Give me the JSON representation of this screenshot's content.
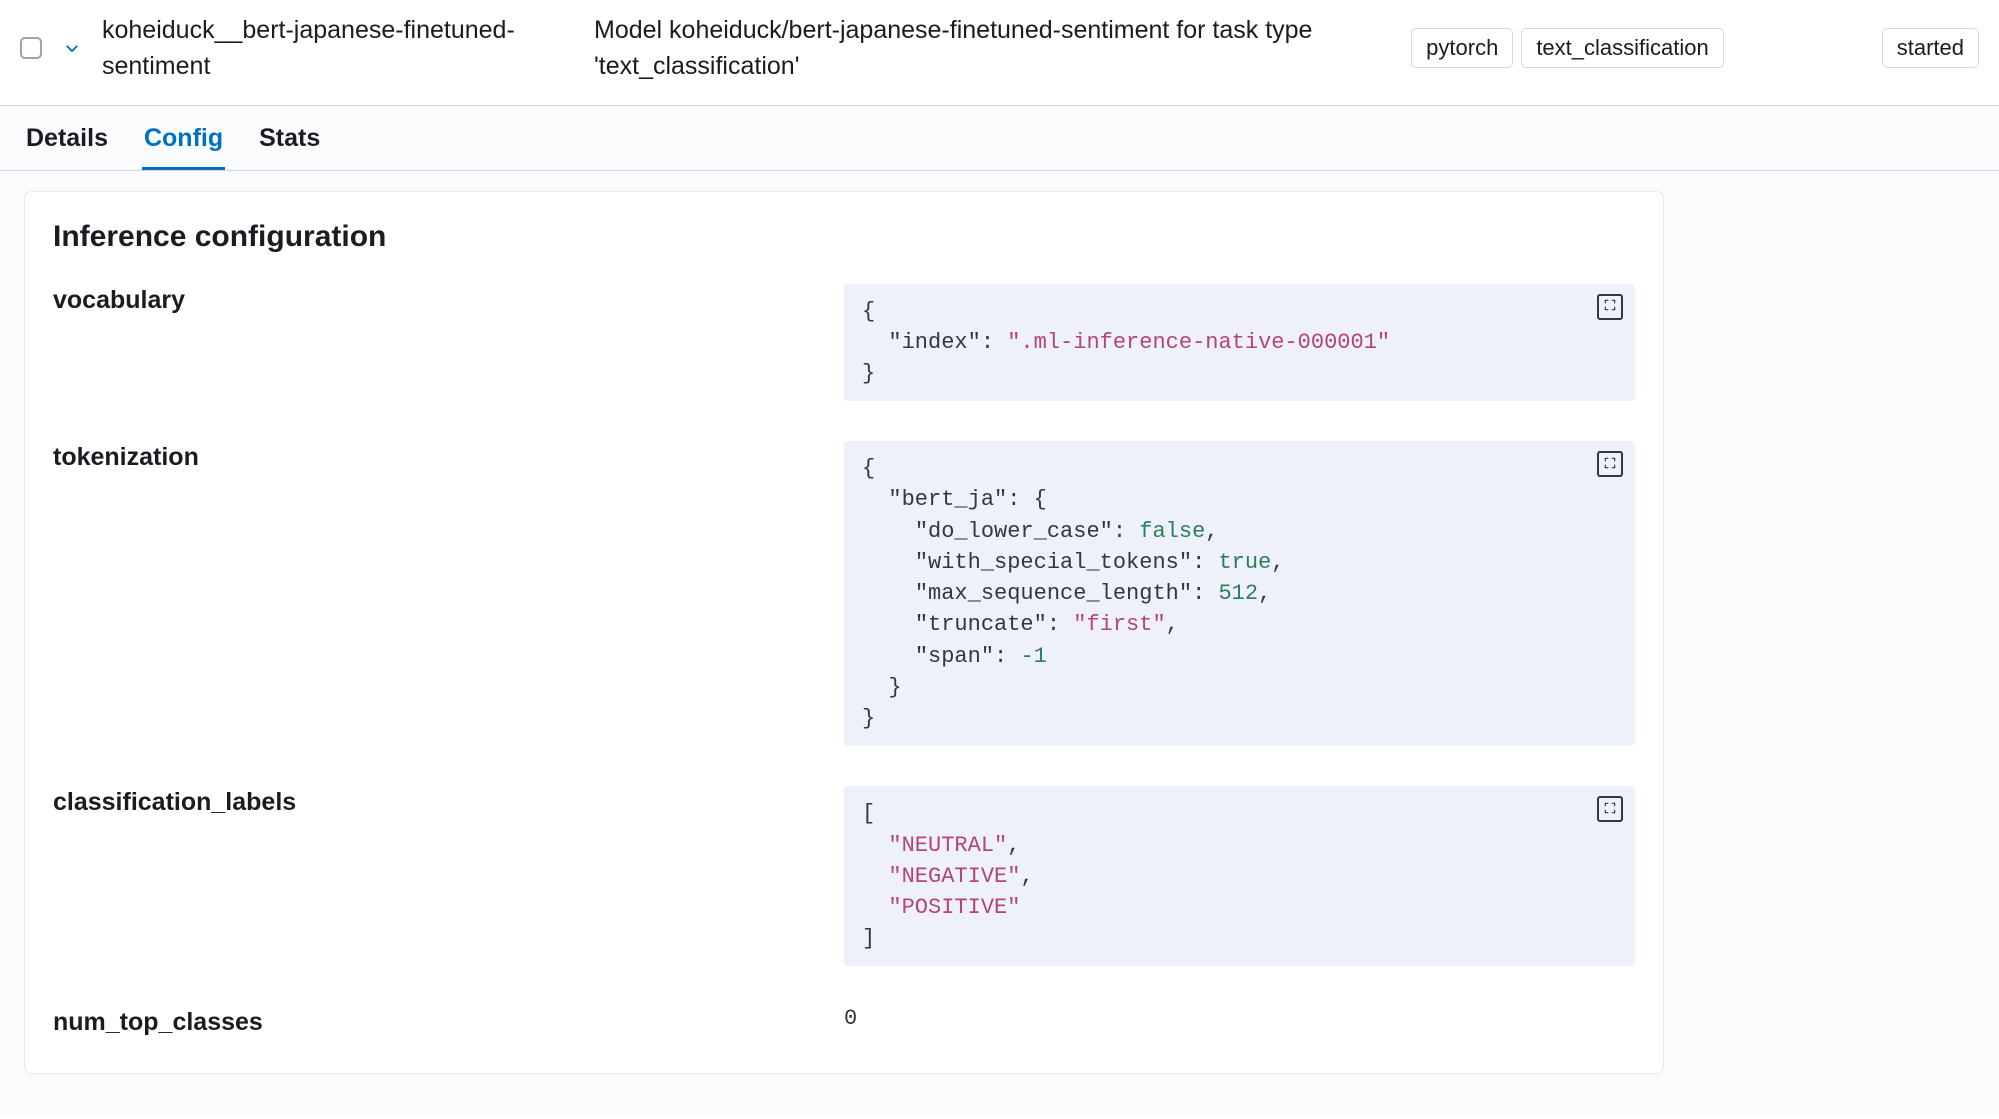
{
  "header": {
    "model_id": "koheiduck__bert-japanese-finetuned-sentiment",
    "description": "Model koheiduck/bert-japanese-finetuned-sentiment for task type 'text_classification'",
    "tags": [
      "pytorch",
      "text_classification"
    ],
    "status": "started"
  },
  "tabs": {
    "details": "Details",
    "config": "Config",
    "stats": "Stats"
  },
  "panel": {
    "title": "Inference configuration",
    "rows": {
      "vocabulary": {
        "label": "vocabulary",
        "value": {
          "index": ".ml-inference-native-000001"
        }
      },
      "tokenization": {
        "label": "tokenization",
        "value": {
          "bert_ja": {
            "do_lower_case": false,
            "with_special_tokens": true,
            "max_sequence_length": 512,
            "truncate": "first",
            "span": -1
          }
        }
      },
      "classification_labels": {
        "label": "classification_labels",
        "value": [
          "NEUTRAL",
          "NEGATIVE",
          "POSITIVE"
        ]
      },
      "num_top_classes": {
        "label": "num_top_classes",
        "value": 0
      }
    }
  }
}
